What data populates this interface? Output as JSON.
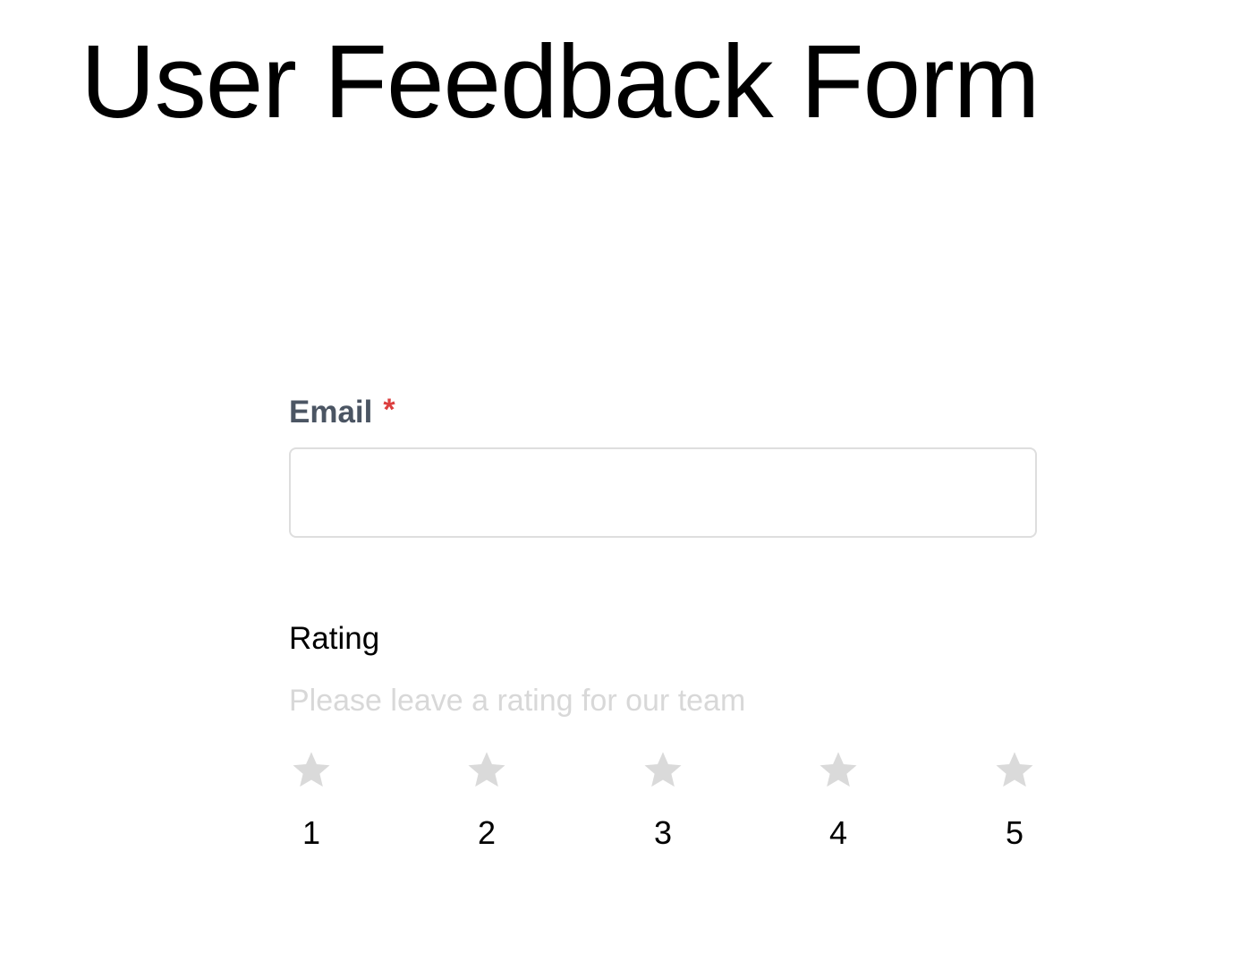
{
  "page": {
    "title": "User Feedback Form"
  },
  "email": {
    "label": "Email",
    "required_mark": "*",
    "value": "",
    "placeholder": ""
  },
  "rating": {
    "label": "Rating",
    "hint": "Please leave a rating for our team",
    "selected": 0,
    "options": [
      {
        "label": "1",
        "icon": "star-icon"
      },
      {
        "label": "2",
        "icon": "star-icon"
      },
      {
        "label": "3",
        "icon": "star-icon"
      },
      {
        "label": "4",
        "icon": "star-icon"
      },
      {
        "label": "5",
        "icon": "star-icon"
      }
    ]
  },
  "colors": {
    "required": "#dc3f3f",
    "star_inactive": "#dadada",
    "label": "#4b5563",
    "hint": "#d8d8d8",
    "input_border": "#dedede"
  }
}
